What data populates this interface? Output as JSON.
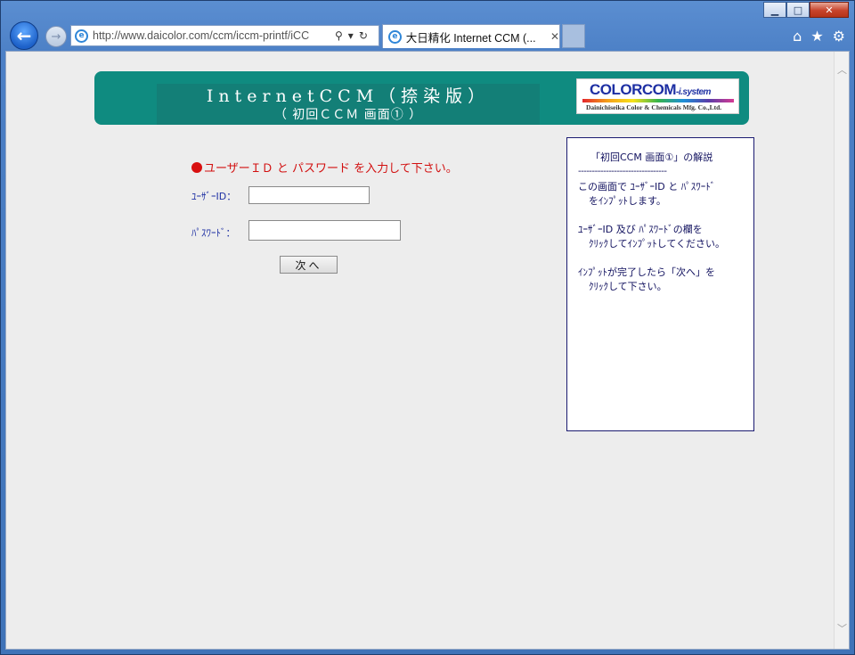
{
  "browser": {
    "address": "http://www.daicolor.com/ccm/iccm-printf/iCC",
    "tab_title": "大日精化 Internet CCM (...",
    "win_min": "▁",
    "win_max": "□",
    "win_close": "✕"
  },
  "banner": {
    "title": "InternetCCM（捺染版）",
    "subtitle": "（ 初回ＣＣＭ 画面① ）",
    "logo_main": "COLORCOM",
    "logo_suffix": "-i.system",
    "logo_sub": "Dainichiseika Color & Chemicals Mfg. Co.,Ltd."
  },
  "form": {
    "instruction": "ユーザーＩＤ と パスワード を入力して下さい。",
    "user_label": "ﾕｰｻﾞｰID：",
    "user_value": "",
    "pass_label": "ﾊﾟｽﾜｰﾄﾞ：",
    "pass_value": "",
    "next_label": "次へ"
  },
  "help": {
    "title": "「初回CCM 画面①」の解説",
    "rule": "--------------------------------",
    "p1_l1": "この画面で ﾕｰｻﾞｰID と ﾊﾟｽﾜｰﾄﾞ",
    "p1_l2": "をｲﾝﾌﾟｯﾄします。",
    "p2_l1": "ﾕｰｻﾞｰID 及び ﾊﾟｽﾜｰﾄﾞの欄を",
    "p2_l2": "ｸﾘｯｸしてｲﾝﾌﾟｯﾄしてください。",
    "p3_l1": "ｲﾝﾌﾟｯﾄが完了したら「次へ」を",
    "p3_l2": "ｸﾘｯｸして下さい。"
  }
}
